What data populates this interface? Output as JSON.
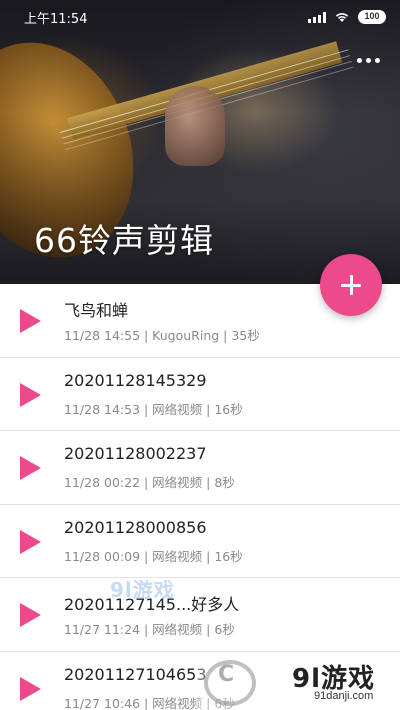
{
  "status_bar": {
    "time": "上午11:54",
    "battery": "100",
    "icons": [
      "signal-icon",
      "wifi-icon",
      "battery-icon"
    ]
  },
  "header": {
    "title": "66铃声剪辑",
    "menu_icon": "more-dots-icon",
    "background": "guitar-photo"
  },
  "fab": {
    "icon": "plus-icon",
    "color": "#ec4a8c"
  },
  "accent_color": "#ec4a8c",
  "list": {
    "items": [
      {
        "title": "飞鸟和蝉",
        "meta": "11/28 14:55 | KugouRing | 35秒"
      },
      {
        "title": "20201128145329",
        "meta": "11/28 14:53 | 网络视频 | 16秒"
      },
      {
        "title": "20201128002237",
        "meta": "11/28 00:22 | 网络视频 | 8秒"
      },
      {
        "title": "20201128000856",
        "meta": "11/28 00:09 | 网络视频 | 16秒"
      },
      {
        "title": "20201127145...好多人",
        "meta": "11/27 11:24 | 网络视频 | 6秒"
      },
      {
        "title": "20201127104653",
        "meta": "11/27 10:46 | 网络视频 | 6秒"
      }
    ]
  },
  "watermarks": {
    "center": "9l游戏",
    "brand": "9l游戏",
    "url": "91danji.com"
  }
}
